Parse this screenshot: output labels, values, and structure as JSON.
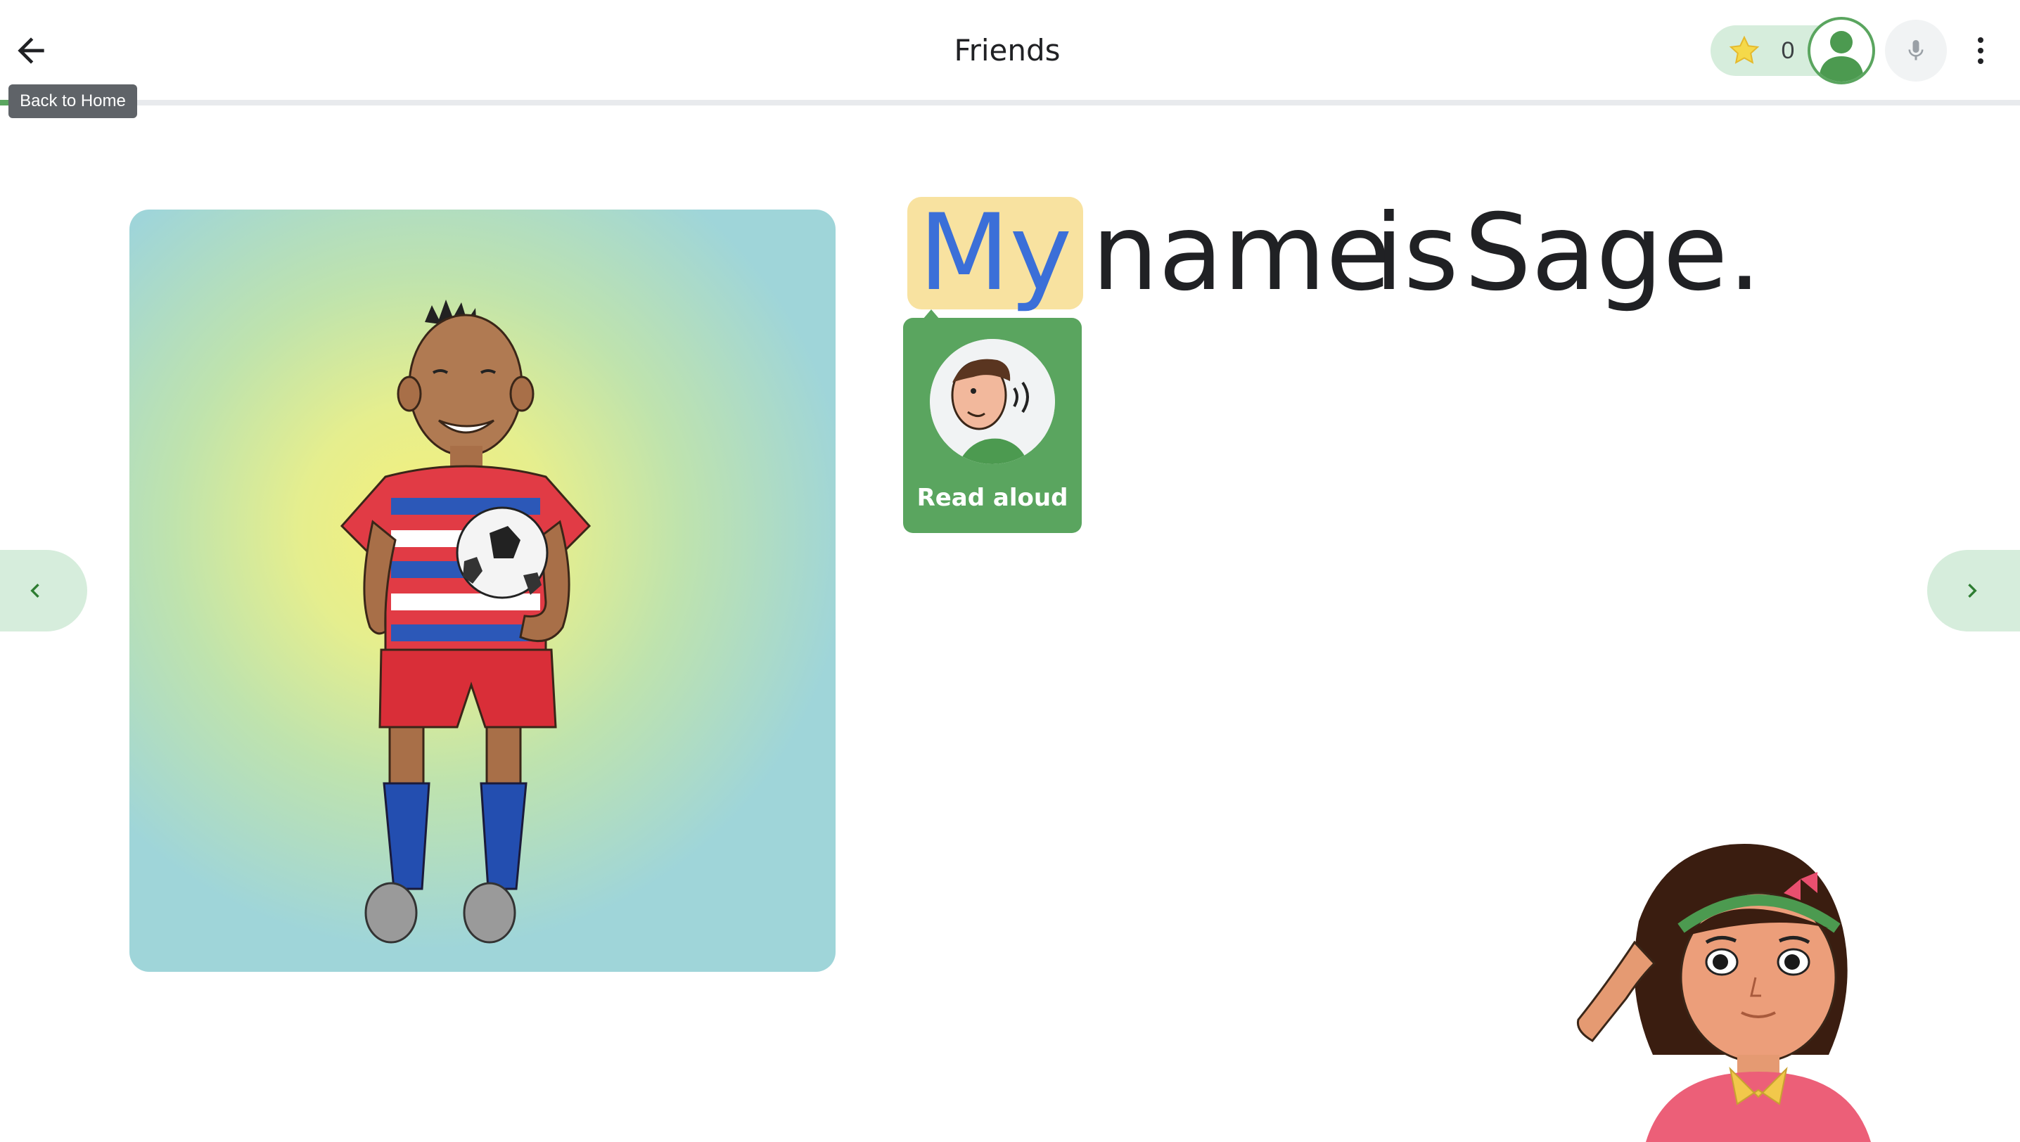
{
  "header": {
    "title": "Friends",
    "back_tooltip": "Back to Home",
    "stars_count": "0",
    "progress_fraction": 0.05
  },
  "icons": {
    "back": "arrow-left-icon",
    "star": "star-icon",
    "avatar": "user-avatar-icon",
    "mic": "microphone-icon",
    "more": "more-vert-icon",
    "prev": "chevron-left-icon",
    "next": "chevron-right-icon"
  },
  "sentence": {
    "words": [
      "My",
      "name",
      "is",
      "Sage."
    ],
    "highlighted_index": 0
  },
  "read_aloud": {
    "label": "Read aloud"
  },
  "colors": {
    "accent_green": "#5aa55f",
    "pill_green": "#d6eddc",
    "highlight_bg": "#f8e2a0",
    "highlight_text": "#3b6fd8"
  }
}
